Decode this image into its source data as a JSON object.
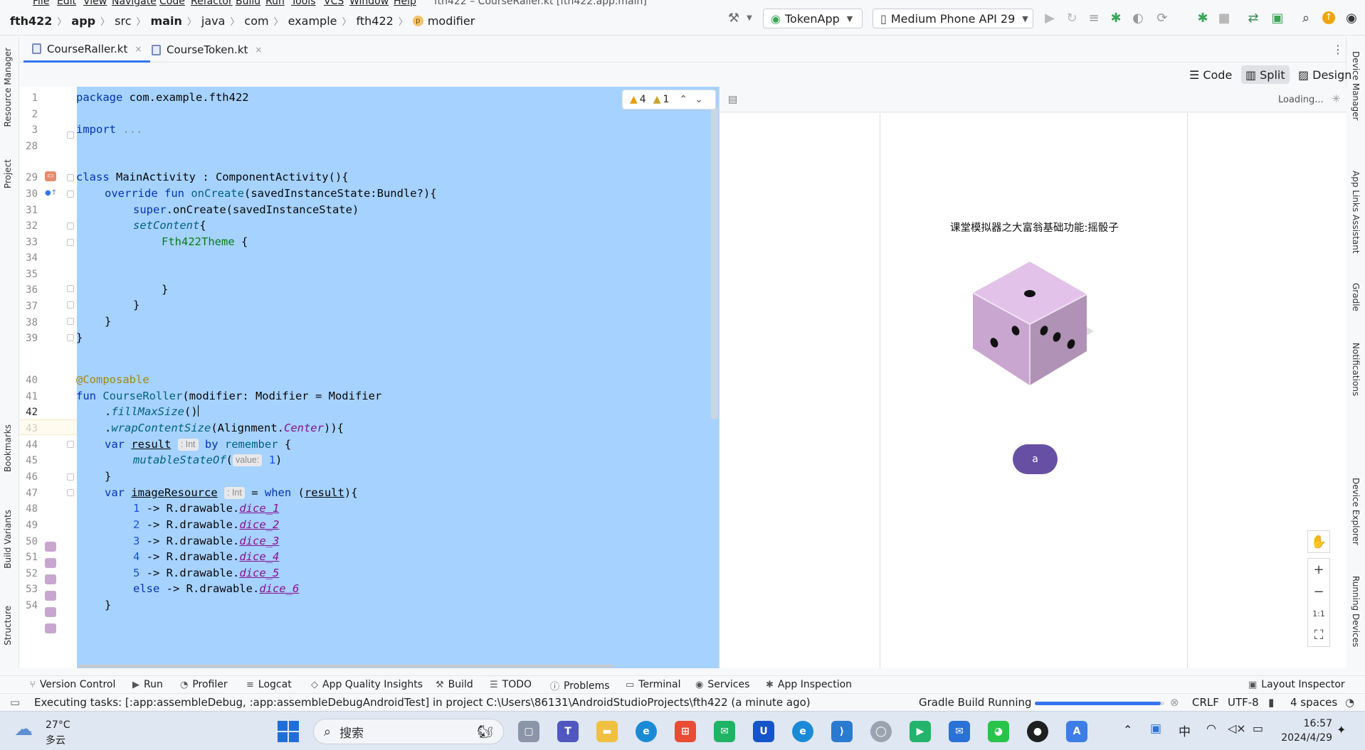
{
  "menubar": {
    "items": [
      "File",
      "Edit",
      "View",
      "Navigate",
      "Code",
      "Refactor",
      "Build",
      "Run",
      "Tools",
      "VCS",
      "Window",
      "Help"
    ],
    "title": "fth422 – CourseRaller.kt [fth422.app.main]"
  },
  "breadcrumb": {
    "project": "fth422",
    "module": "app",
    "src": "src",
    "main": "main",
    "java": "java",
    "com": "com",
    "example": "example",
    "pkg": "fth422",
    "member_badge": "p",
    "member": "modifier"
  },
  "toolbar": {
    "run_config": "TokenApp",
    "device": "Medium Phone API 29"
  },
  "tabs": [
    {
      "label": "CourseRaller.kt",
      "close": "×"
    },
    {
      "label": "CourseToken.kt",
      "close": "×"
    }
  ],
  "view_modes": {
    "code": "Code",
    "split": "Split",
    "design": "Design"
  },
  "inspections": {
    "warnings": "4",
    "weak_warnings": "1"
  },
  "gutter": {
    "lines": [
      "1",
      "2",
      "3",
      "28",
      "29",
      "30",
      "31",
      "32",
      "33",
      "34",
      "35",
      "36",
      "37",
      "38",
      "39",
      "40",
      "41",
      "42",
      "43",
      "44",
      "45",
      "46",
      "47",
      "48",
      "49",
      "50",
      "51",
      "52",
      "53",
      "54"
    ],
    "current_line": "42"
  },
  "code": {
    "l1_kw": "package",
    "l1_rest": " com.example.fth422",
    "l3_kw": "import",
    "l3_rest": " ...",
    "l29_kw": "class",
    "l29_rest": " MainActivity : ComponentActivity(){",
    "l30_kw": "override fun",
    "l30_fn": " onCreate",
    "l30_rest": "(savedInstanceState:Bundle?){",
    "l31_kw": "super",
    "l31_rest": ".onCreate(savedInstanceState)",
    "l32_fn": "setContent",
    "l32_rest": "{",
    "l33_fn": "Fth422Theme",
    "l33_rest": " {",
    "l35": "}",
    "l36": "}",
    "l37": "}",
    "l38": "}",
    "l40": "@Composable",
    "l41_kw": "fun",
    "l41_fn": " CourseRoller",
    "l41_rest": "(modifier: Modifier = Modifier",
    "l42_dot": ".",
    "l42_fn": "fillMaxSize",
    "l42_rest": "()",
    "l43_dot": ".",
    "l43_fn": "wrapContentSize",
    "l43_a": "(Alignment.",
    "l43_b": "Center",
    "l43_c": ")){",
    "l44_kw": "var",
    "l44_var": "result",
    "l44_hint": ": Int",
    "l44_by": "by",
    "l44_fn": "remember",
    "l44_rest": " {",
    "l45_fn": "mutableStateOf",
    "l45_a": "(",
    "l45_hint": "value:",
    "l45_num": "1",
    "l45_b": ")",
    "l46": "}",
    "l47_kw": "var",
    "l47_var": "imageResource",
    "l47_hint": ": Int",
    "l47_mid": " = ",
    "l47_when": "when",
    "l47_a": " (",
    "l47_res": "result",
    "l47_b": "){",
    "dice": [
      {
        "n": "1",
        "arrow": " -> R.drawable.",
        "res": "dice_1"
      },
      {
        "n": "2",
        "arrow": " -> R.drawable.",
        "res": "dice_2"
      },
      {
        "n": "3",
        "arrow": " -> R.drawable.",
        "res": "dice_3"
      },
      {
        "n": "4",
        "arrow": " -> R.drawable.",
        "res": "dice_4"
      },
      {
        "n": "5",
        "arrow": " -> R.drawable.",
        "res": "dice_5"
      }
    ],
    "l53_kw": "else",
    "l53_arrow": " -> R.drawable.",
    "l53_res": "dice_6",
    "l54": "}"
  },
  "preview": {
    "status": "Loading...",
    "app_title": "课堂模拟器之大富翁基础功能:摇骰子",
    "roll_button": "a",
    "zoom_ratio": "1:1"
  },
  "left_tools": [
    "Resource Manager",
    "Project",
    "Bookmarks",
    "Build Variants",
    "Structure"
  ],
  "right_tools": [
    "Device Manager",
    "App Links Assistant",
    "Gradle",
    "Notifications",
    "Device Explorer",
    "Running Devices"
  ],
  "bottom_tools": [
    "Version Control",
    "Run",
    "Profiler",
    "Logcat",
    "App Quality Insights",
    "Build",
    "TODO",
    "Problems",
    "Terminal",
    "Services",
    "App Inspection",
    "Layout Inspector"
  ],
  "status": {
    "message": "Executing tasks: [:app:assembleDebug, :app:assembleDebugAndroidTest] in project C:\\Users\\86131\\AndroidStudioProjects\\fth422 (a minute ago)",
    "gradle": "Gradle Build Running",
    "progress": 0.97,
    "line_sep": "CRLF",
    "encoding": "UTF-8",
    "indent": "4 spaces"
  },
  "taskbar": {
    "weather_temp": "27°C",
    "weather_desc": "多云",
    "search_placeholder": "搜索",
    "ime": "中",
    "time": "16:57",
    "date": "2024/4/29"
  },
  "colors": {
    "selection": "#a6d2ff",
    "accent": "#3574f0",
    "button": "#6750a4",
    "dice_top": "#e2c2e9",
    "dice_left": "#c9a6cf",
    "dice_right": "#b092b6"
  }
}
